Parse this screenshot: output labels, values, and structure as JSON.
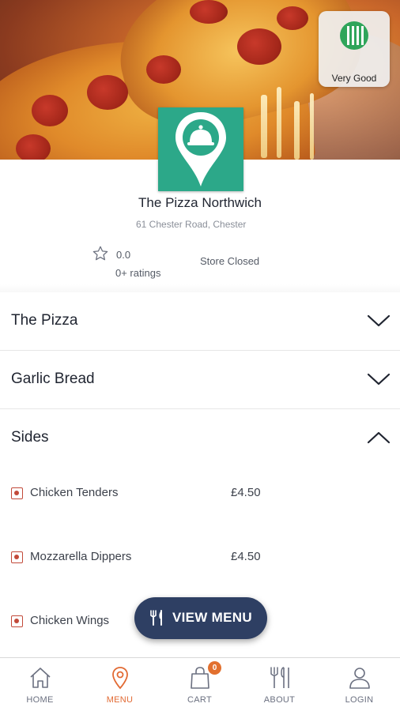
{
  "badge": {
    "label": "Very Good",
    "icon": "hygiene-rating-icon",
    "color": "#2fa55a"
  },
  "store": {
    "name": "The Pizza Northwich",
    "address": "61 Chester Road, Chester",
    "rating": "0.0",
    "rating_count": "0+ ratings",
    "status": "Store Closed",
    "logo_icon": "location-pin-cloche-icon",
    "brand_color": "#2ca889"
  },
  "categories": [
    {
      "label": "The Pizza",
      "expanded": false
    },
    {
      "label": "Garlic Bread",
      "expanded": false
    },
    {
      "label": "Sides",
      "expanded": true
    }
  ],
  "items": [
    {
      "name": "Chicken Tenders",
      "price": "£4.50"
    },
    {
      "name": "Mozzarella Dippers",
      "price": "£4.50"
    },
    {
      "name": "Chicken Wings",
      "price": ""
    }
  ],
  "view_menu": {
    "label": "VIEW MENU",
    "icon": "cutlery-icon",
    "color": "#2e3f63"
  },
  "nav": {
    "home": "HOME",
    "menu": "MENU",
    "cart": "CART",
    "cart_count": "0",
    "about": "ABOUT",
    "login": "LOGIN",
    "active": "menu",
    "accent": "#e26a33"
  }
}
